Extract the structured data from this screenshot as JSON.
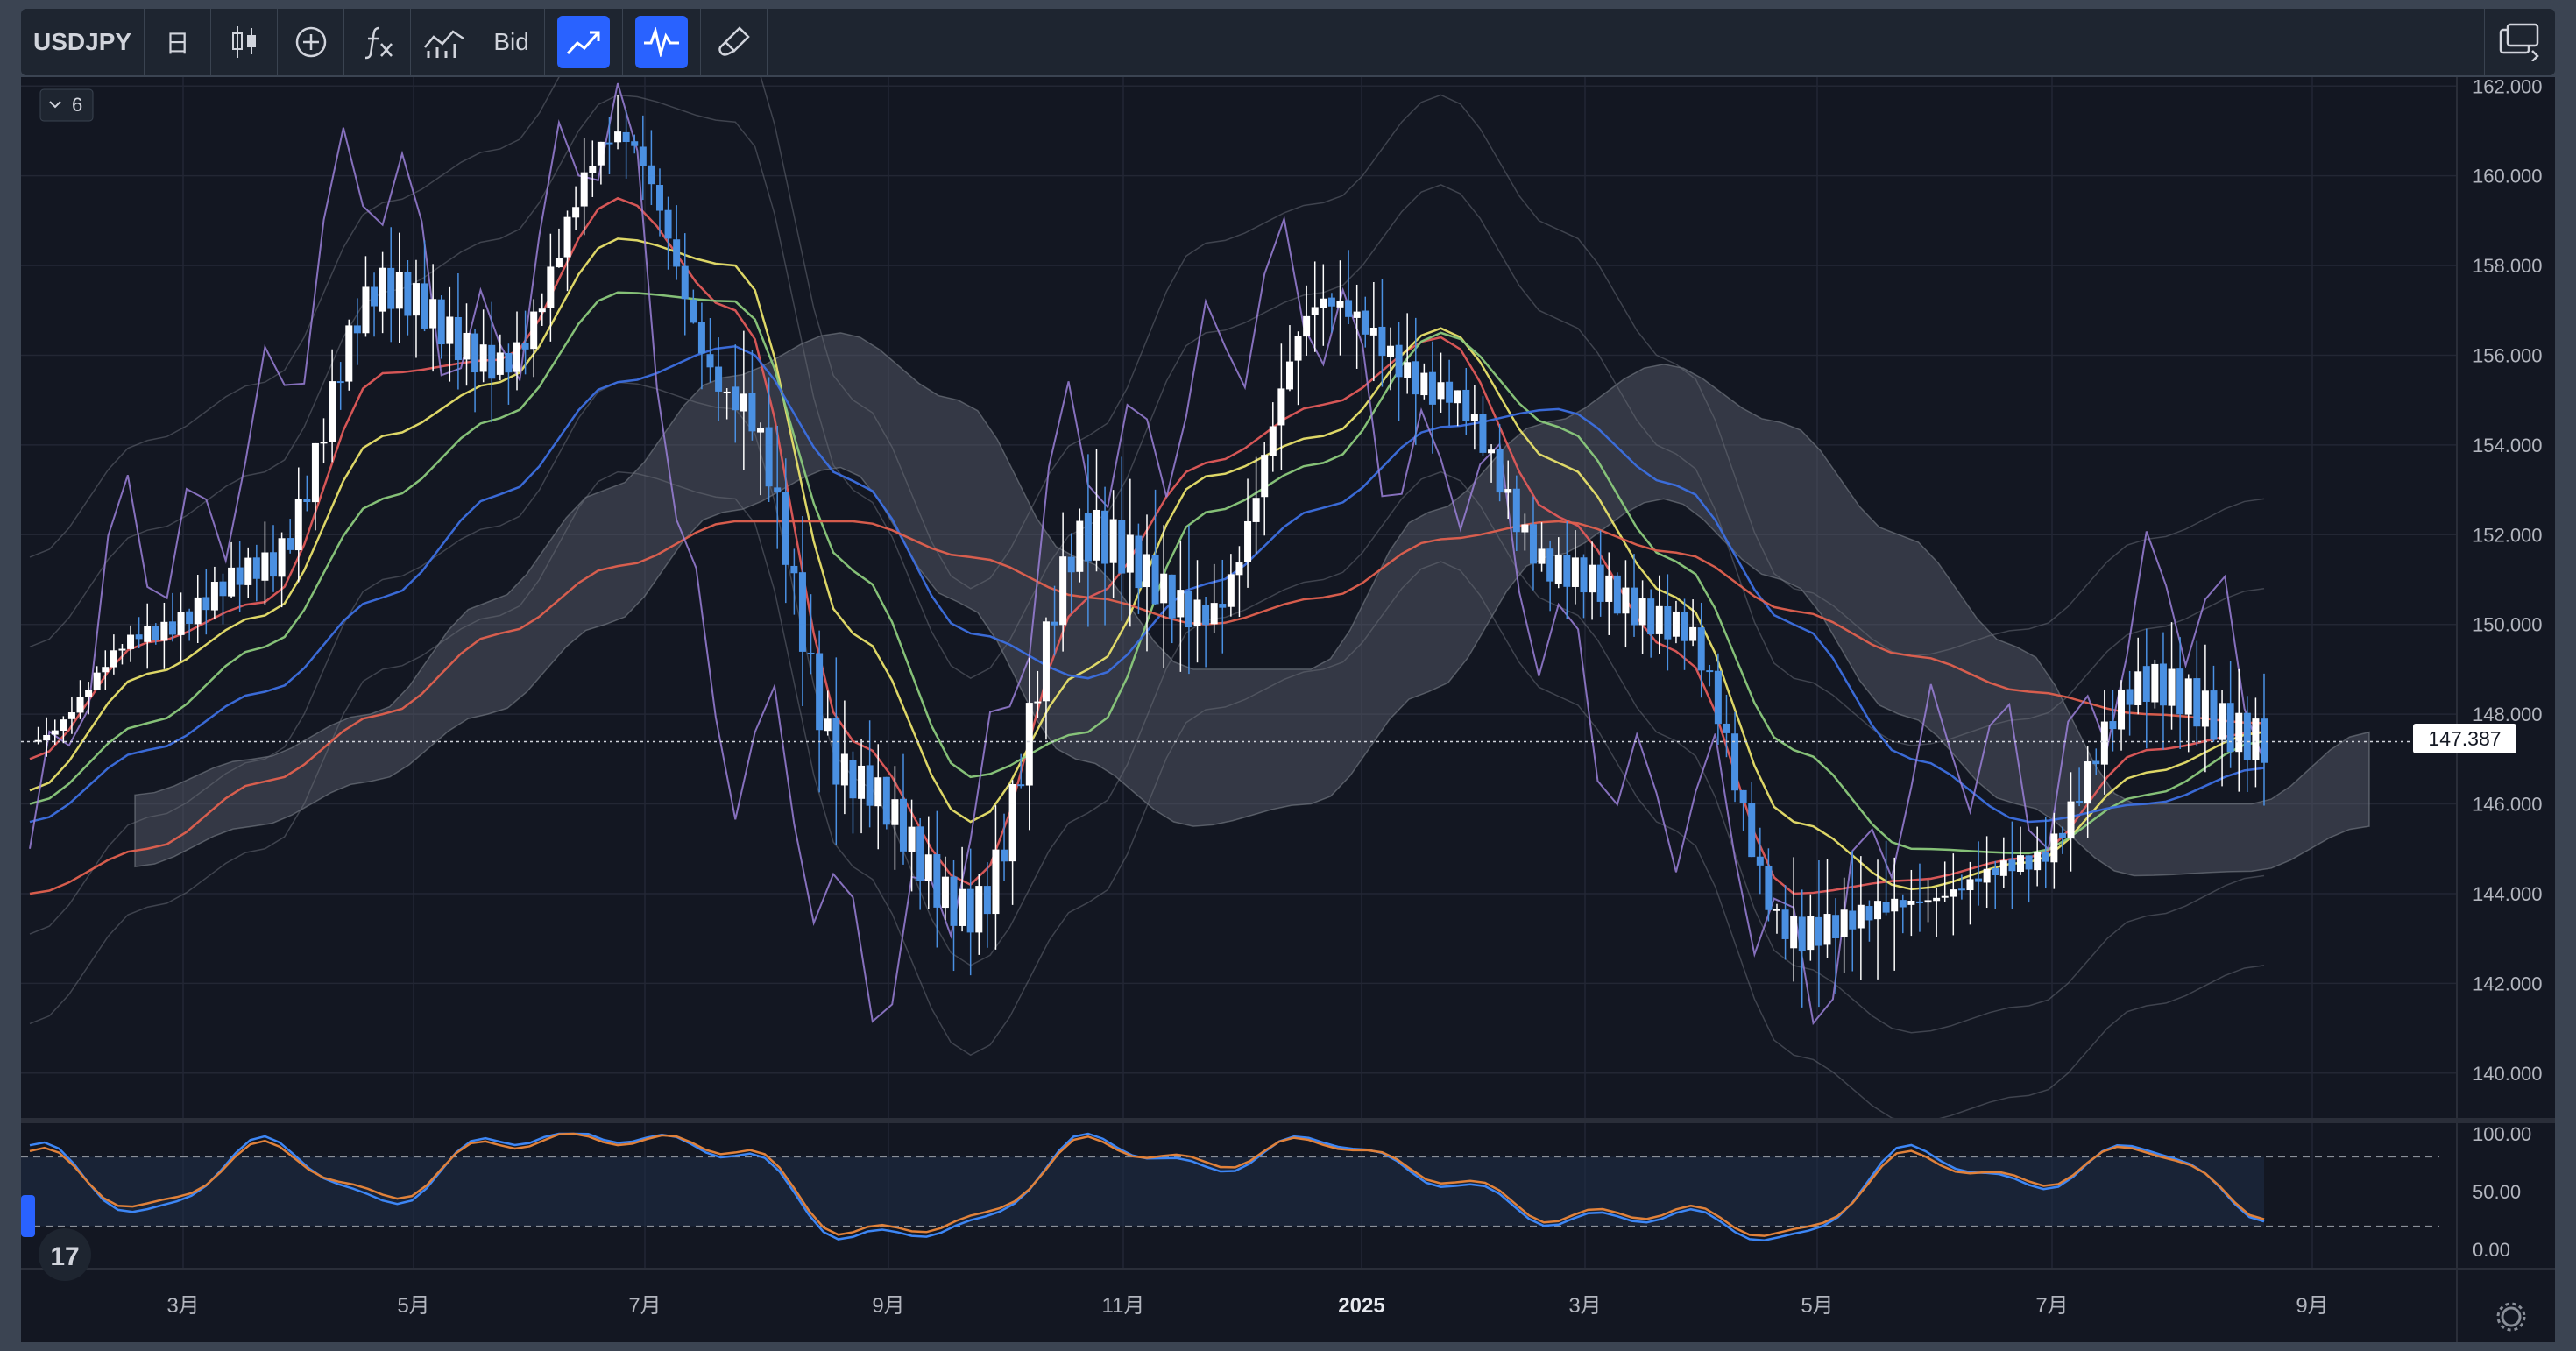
{
  "toolbar": {
    "symbol": "USDJPY",
    "interval": "日",
    "price_type": "Bid",
    "items": [
      "candles-icon",
      "add-indicator-icon",
      "fx-icon",
      "indicators-icon",
      "compare-icon",
      "oscillator-icon",
      "brush-icon",
      "layout-icon"
    ]
  },
  "legend_toggle": {
    "count": "6"
  },
  "last_price_label": "147.387",
  "colors": {
    "background": "#131722",
    "bull_candle": "#ffffff",
    "bear_candle": "#4a90e2",
    "sma_red": "#e05a5a",
    "sma_yellow": "#e8e06a",
    "sma_green": "#8bc97c",
    "sma_blue": "#3c6fe0",
    "sma_long": "#e0604f",
    "purple": "#9b80d8",
    "stoch_k": "#3d86f5",
    "stoch_d": "#e0813a",
    "accent": "#2962ff"
  },
  "chart_data": [
    {
      "type": "candlestick",
      "title": "",
      "xlabel": "",
      "ylabel": "",
      "x_ticks": [
        "3月",
        "5月",
        "7月",
        "9月",
        "11月",
        "2025",
        "3月",
        "5月",
        "7月",
        "9月"
      ],
      "y_ticks": [
        "162.000",
        "160.000",
        "158.000",
        "156.000",
        "154.000",
        "152.000",
        "150.000",
        "148.000",
        "146.000",
        "144.000",
        "142.000",
        "140.000"
      ],
      "ylim": [
        139.0,
        162.2
      ],
      "grid": true,
      "last_price": 147.387,
      "x": [
        "2024-01",
        "2024-02",
        "2024-03",
        "2024-04",
        "2024-05",
        "2024-06",
        "2024-07",
        "2024-08",
        "2024-09",
        "2024-10",
        "2024-11",
        "2024-12",
        "2025-01",
        "2025-02",
        "2025-03",
        "2025-04",
        "2025-05",
        "2025-06",
        "2025-07",
        "2025-08"
      ],
      "close": [
        147.4,
        149.8,
        151.3,
        157.5,
        155.8,
        160.9,
        155.0,
        146.5,
        143.6,
        152.0,
        150.2,
        157.2,
        155.2,
        151.2,
        150.0,
        143.1,
        143.8,
        144.7,
        148.7,
        147.4
      ],
      "high": [
        148.6,
        150.8,
        151.9,
        158.4,
        157.6,
        161.8,
        161.9,
        149.3,
        147.2,
        153.2,
        156.7,
        158.1,
        158.8,
        155.8,
        151.4,
        150.2,
        148.6,
        148.0,
        150.9,
        148.5
      ],
      "low": [
        145.6,
        146.0,
        146.5,
        151.0,
        151.8,
        155.6,
        151.3,
        141.7,
        139.6,
        142.1,
        149.0,
        149.5,
        153.8,
        150.0,
        146.5,
        139.9,
        142.1,
        142.2,
        143.0,
        146.2
      ],
      "series": [
        {
          "name": "",
          "color": "#e05a5a",
          "values": [
            147.0,
            149.6,
            150.5,
            155.6,
            155.9,
            159.5,
            157.0,
            147.4,
            144.2,
            150.6,
            153.6,
            154.9,
            156.4,
            152.4,
            149.4,
            144.0,
            144.3,
            144.8,
            147.2,
            147.6
          ]
        },
        {
          "name": "",
          "color": "#e8e06a",
          "values": [
            146.3,
            148.9,
            150.2,
            154.2,
            155.4,
            158.6,
            158.0,
            149.8,
            145.6,
            149.0,
            153.3,
            154.2,
            156.6,
            153.6,
            150.6,
            145.6,
            144.1,
            144.7,
            146.7,
            147.6
          ]
        },
        {
          "name": "",
          "color": "#8bc97c",
          "values": [
            146.0,
            147.8,
            149.5,
            152.8,
            154.6,
            157.4,
            157.2,
            151.2,
            146.6,
            147.6,
            152.5,
            153.6,
            156.5,
            154.4,
            151.4,
            147.2,
            145.0,
            144.9,
            146.2,
            147.4
          ]
        },
        {
          "name": "",
          "color": "#3c6fe0",
          "values": [
            145.6,
            147.2,
            148.5,
            150.6,
            152.9,
            155.4,
            156.2,
            153.2,
            149.8,
            148.8,
            150.9,
            152.6,
            154.4,
            154.8,
            153.1,
            150.0,
            147.0,
            145.6,
            146.0,
            146.8
          ]
        },
        {
          "name": "",
          "color": "#e0604f",
          "values": [
            144.0,
            145.0,
            146.5,
            148.0,
            149.8,
            151.3,
            152.3,
            152.3,
            151.5,
            150.6,
            150.0,
            150.6,
            151.9,
            152.3,
            151.6,
            150.3,
            149.3,
            148.5,
            148.0,
            147.8
          ]
        },
        {
          "name": "",
          "color": "#9b80d8",
          "values": [
            145.0,
            152.0,
            154.5,
            160.2,
            156.0,
            161.2,
            147.0,
            143.0,
            145.0,
            154.5,
            155.2,
            157.5,
            153.0,
            150.0,
            145.5,
            143.0,
            146.0,
            147.0,
            149.8,
            149.0
          ]
        }
      ],
      "cloud_upper": [
        146.2,
        147.0,
        148.0,
        150.5,
        153.0,
        155.5,
        156.5,
        155.0,
        151.5,
        149.0,
        149.0,
        152.5,
        154.5,
        155.8,
        154.5,
        152.0,
        149.5,
        146.0,
        146.0,
        147.6
      ],
      "cloud_lower": [
        144.6,
        145.5,
        146.5,
        148.0,
        150.0,
        152.5,
        153.5,
        150.5,
        147.0,
        145.5,
        146.0,
        148.5,
        151.5,
        152.8,
        151.0,
        148.0,
        146.0,
        144.4,
        144.5,
        145.5
      ]
    },
    {
      "type": "line",
      "title": "",
      "y_ticks": [
        "100.00",
        "50.00",
        "0.00"
      ],
      "ylim": [
        0,
        100
      ],
      "levels": [
        80,
        20
      ],
      "series": [
        {
          "name": "",
          "color": "#3d86f5",
          "values": [
            90,
            30,
            92,
            40,
            96,
            98,
            85,
            10,
            20,
            95,
            70,
            96,
            60,
            25,
            30,
            8,
            85,
            55,
            90,
            30
          ]
        },
        {
          "name": "",
          "color": "#e0813a",
          "values": [
            85,
            35,
            88,
            45,
            93,
            96,
            88,
            14,
            24,
            92,
            74,
            94,
            63,
            28,
            33,
            12,
            80,
            58,
            88,
            32
          ]
        }
      ]
    }
  ]
}
